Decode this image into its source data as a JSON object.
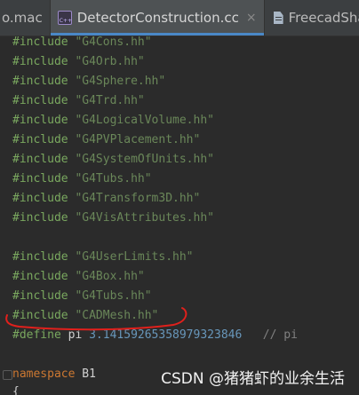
{
  "tabs": [
    {
      "label": "o.mac",
      "active": false,
      "closable": false
    },
    {
      "label": "DetectorConstruction.cc",
      "active": true,
      "closable": true,
      "icon": "cpp-file-icon",
      "close": "×"
    },
    {
      "label": "FreecadShape",
      "active": false,
      "closable": false,
      "icon": "file-icon"
    }
  ],
  "code": {
    "include_lines": [
      {
        "directive": "#include",
        "file": "\"G4Cons.hh\""
      },
      {
        "directive": "#include",
        "file": "\"G4Orb.hh\""
      },
      {
        "directive": "#include",
        "file": "\"G4Sphere.hh\""
      },
      {
        "directive": "#include",
        "file": "\"G4Trd.hh\""
      },
      {
        "directive": "#include",
        "file": "\"G4LogicalVolume.hh\""
      },
      {
        "directive": "#include",
        "file": "\"G4PVPlacement.hh\""
      },
      {
        "directive": "#include",
        "file": "\"G4SystemOfUnits.hh\""
      },
      {
        "directive": "#include",
        "file": "\"G4Tubs.hh\""
      },
      {
        "directive": "#include",
        "file": "\"G4Transform3D.hh\""
      },
      {
        "directive": "#include",
        "file": "\"G4VisAttributes.hh\""
      },
      {
        "directive": "",
        "file": ""
      },
      {
        "directive": "#include",
        "file": "\"G4UserLimits.hh\""
      },
      {
        "directive": "#include",
        "file": "\"G4Box.hh\""
      },
      {
        "directive": "#include",
        "file": "\"G4Tubs.hh\""
      },
      {
        "directive": "#include",
        "file": "\"CADMesh.hh\""
      }
    ],
    "define_line": {
      "directive": "#define",
      "name": "pi",
      "value": "3.14159265358979323846",
      "comment": "// pi"
    },
    "namespace_line": {
      "keyword": "namespace",
      "name": "B1"
    },
    "brace_line": "{"
  },
  "annotation": {
    "color": "#e0201c",
    "target": "\"CADMesh.hh\""
  },
  "watermark": "CSDN @猪猪虾的业余生活"
}
